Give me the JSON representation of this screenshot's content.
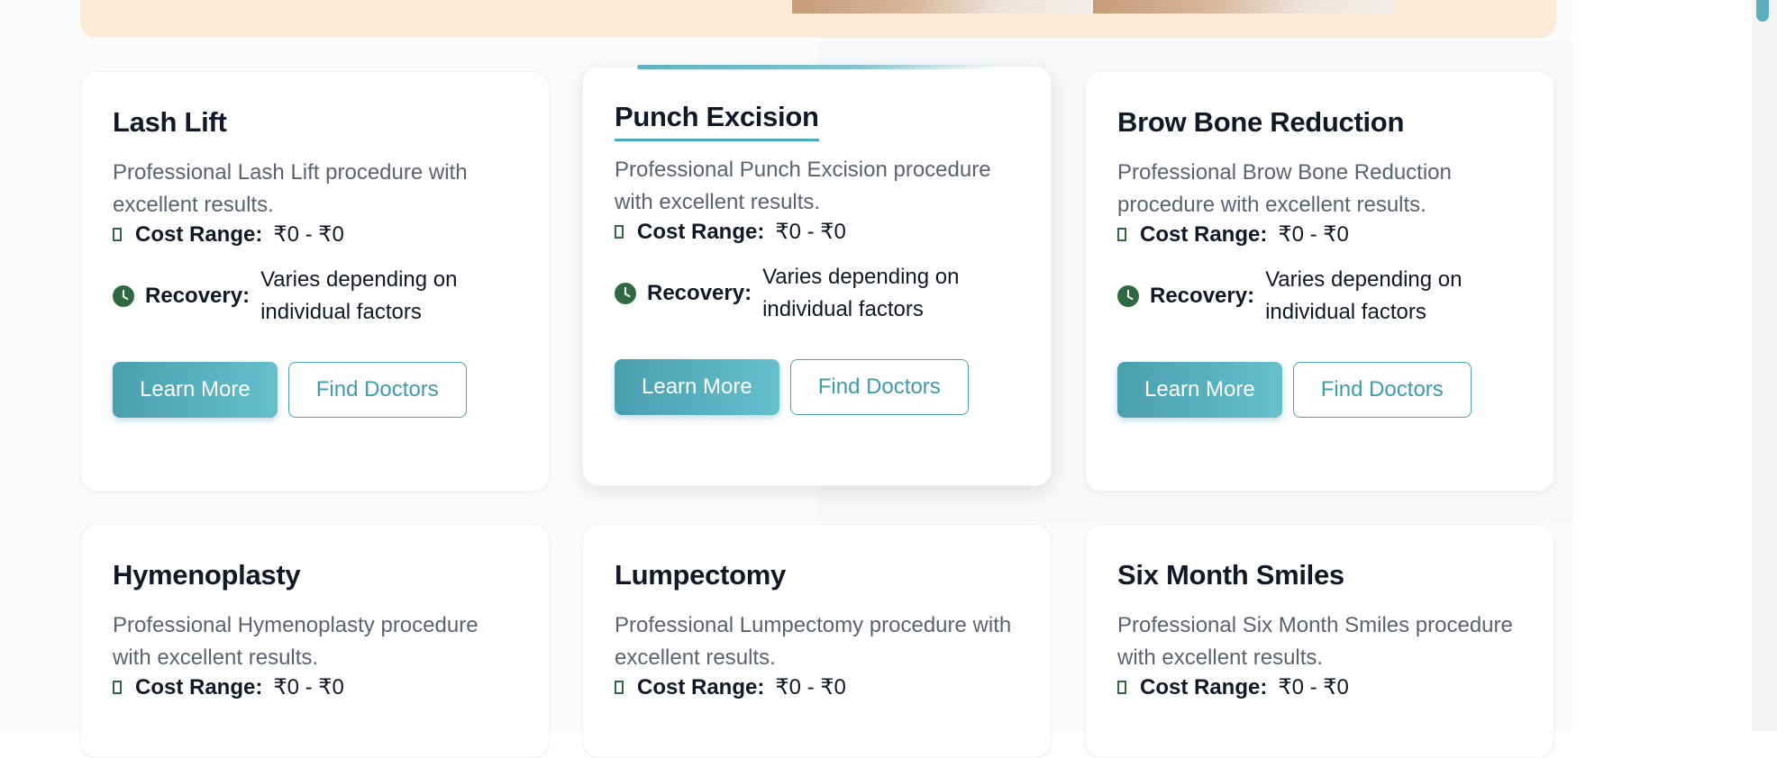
{
  "cards": [
    {
      "title": "Lash Lift",
      "description": "Professional Lash Lift procedure with excellent results.",
      "cost_label": "Cost Range:",
      "cost_value": "₹0 - ₹0",
      "recovery_label": "Recovery:",
      "recovery_value": "Varies depending on individual factors",
      "learn_more": "Learn More",
      "find_doctors": "Find Doctors"
    },
    {
      "title": "Punch Excision",
      "description": "Professional Punch Excision procedure with excellent results.",
      "cost_label": "Cost Range:",
      "cost_value": "₹0 - ₹0",
      "recovery_label": "Recovery:",
      "recovery_value": "Varies depending on individual factors",
      "learn_more": "Learn More",
      "find_doctors": "Find Doctors"
    },
    {
      "title": "Brow Bone Reduction",
      "description": "Professional Brow Bone Reduction procedure with excellent results.",
      "cost_label": "Cost Range:",
      "cost_value": "₹0 - ₹0",
      "recovery_label": "Recovery:",
      "recovery_value": "Varies depending on individual factors",
      "learn_more": "Learn More",
      "find_doctors": "Find Doctors"
    },
    {
      "title": "Hymenoplasty",
      "description": "Professional Hymenoplasty procedure with excellent results.",
      "cost_label": "Cost Range:",
      "cost_value": "₹0 - ₹0"
    },
    {
      "title": "Lumpectomy",
      "description": "Professional Lumpectomy procedure with excellent results.",
      "cost_label": "Cost Range:",
      "cost_value": "₹0 - ₹0"
    },
    {
      "title": "Six Month Smiles",
      "description": "Professional Six Month Smiles procedure with excellent results.",
      "cost_label": "Cost Range:",
      "cost_value": "₹0 - ₹0"
    }
  ],
  "colors": {
    "accent": "#4aa3b3",
    "icon_green": "#2e6a3f",
    "banner": "#fcebd6"
  },
  "icons": {
    "cost": "box-icon",
    "recovery": "clock-icon"
  }
}
